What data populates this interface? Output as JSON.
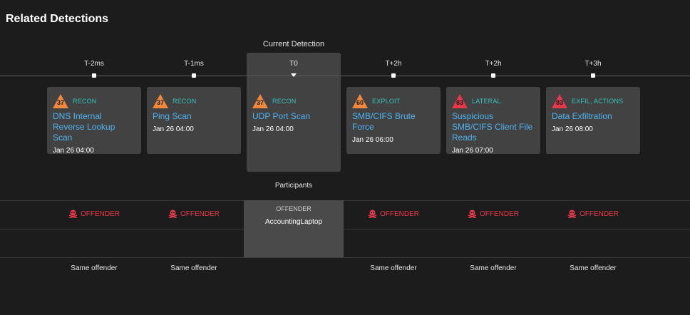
{
  "page_title": "Related Detections",
  "current_header": "Current Detection",
  "ticks": [
    "T-2ms",
    "T-1ms",
    "T0",
    "T+2h",
    "T+2h",
    "T+3h"
  ],
  "detections": [
    {
      "score": "37",
      "score_color": "#f0883e",
      "category": "RECON",
      "title": "DNS Internal Reverse Lookup Scan",
      "time": "Jan 26 04:00"
    },
    {
      "score": "37",
      "score_color": "#f0883e",
      "category": "RECON",
      "title": "Ping Scan",
      "time": "Jan 26 04:00"
    },
    {
      "score": "37",
      "score_color": "#f0883e",
      "category": "RECON",
      "title": "UDP Port Scan",
      "time": "Jan 26 04:00"
    },
    {
      "score": "60",
      "score_color": "#f0883e",
      "category": "EXPLOIT",
      "title": "SMB/CIFS Brute Force",
      "time": "Jan 26 06:00"
    },
    {
      "score": "83",
      "score_color": "#e5394b",
      "category": "LATERAL",
      "title": "Suspicious SMB/CIFS Client File Reads",
      "time": "Jan 26 07:00"
    },
    {
      "score": "83",
      "score_color": "#e5394b",
      "category": "EXFIL, ACTIONS",
      "title": "Data Exfiltration",
      "time": "Jan 26 08:00"
    }
  ],
  "participants_label": "Participants",
  "offender_label": "OFFENDER",
  "current_participant": {
    "role": "OFFENDER",
    "name": "AccountingLaptop"
  },
  "same_offender": "Same offender",
  "colors": {
    "background": "#1c1c1d",
    "card": "#424243",
    "accent_teal": "#33c2bc",
    "link_blue": "#4fb3f0",
    "offender_red": "#e8394a"
  },
  "icons": {
    "offender": "skull-crossbones-icon",
    "score": "warning-triangle-icon"
  }
}
